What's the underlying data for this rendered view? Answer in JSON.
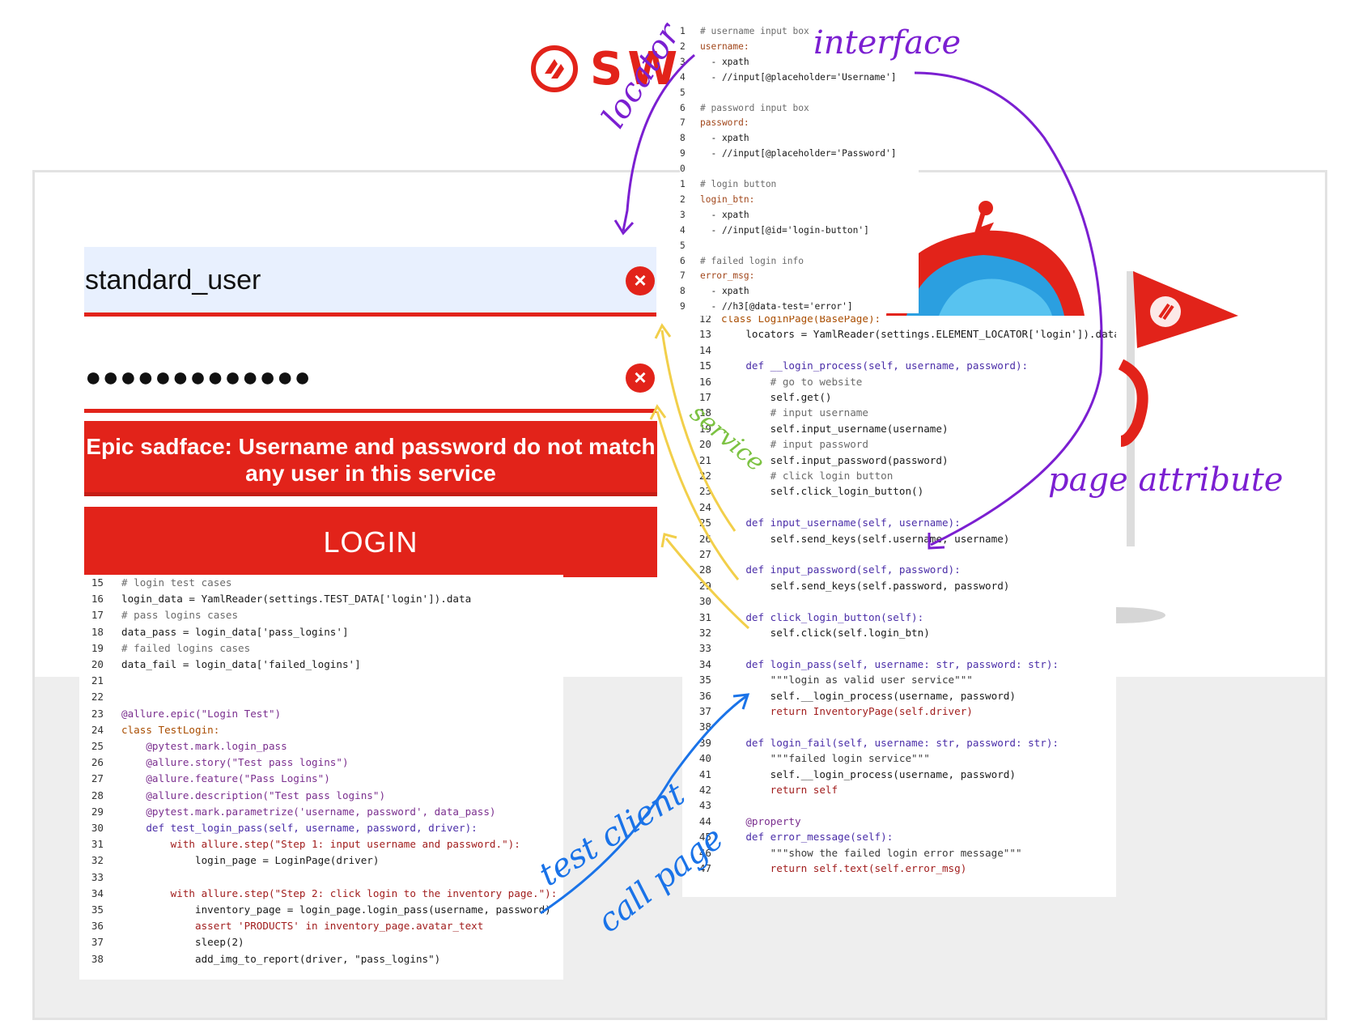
{
  "brand": {
    "text": "SWA"
  },
  "login_form": {
    "username_value": "standard_user",
    "password_value": "●●●●●●●●●●●●●",
    "field_error_icon": "x-circle-icon",
    "error_message": "Epic sadface: Username and password do not match any user in this service",
    "error_close": "✕",
    "login_label": "LOGIN"
  },
  "yaml_code": [
    {
      "n": "1",
      "t": "# username input box",
      "c": "com"
    },
    {
      "n": "2",
      "t": "username:",
      "c": "key"
    },
    {
      "n": "3",
      "t": "  - xpath",
      "c": ""
    },
    {
      "n": "4",
      "t": "  - //input[@placeholder='Username']",
      "c": ""
    },
    {
      "n": "5",
      "t": "",
      "c": ""
    },
    {
      "n": "6",
      "t": "# password input box",
      "c": "com"
    },
    {
      "n": "7",
      "t": "password:",
      "c": "key"
    },
    {
      "n": "8",
      "t": "  - xpath",
      "c": ""
    },
    {
      "n": "9",
      "t": "  - //input[@placeholder='Password']",
      "c": ""
    },
    {
      "n": "0",
      "t": "",
      "c": ""
    },
    {
      "n": "1",
      "t": "# login button",
      "c": "com"
    },
    {
      "n": "2",
      "t": "login_btn:",
      "c": "key"
    },
    {
      "n": "3",
      "t": "  - xpath",
      "c": ""
    },
    {
      "n": "4",
      "t": "  - //input[@id='login-button']",
      "c": ""
    },
    {
      "n": "5",
      "t": "",
      "c": ""
    },
    {
      "n": "6",
      "t": "# failed login info",
      "c": "com"
    },
    {
      "n": "7",
      "t": "error_msg:",
      "c": "key"
    },
    {
      "n": "8",
      "t": "  - xpath",
      "c": ""
    },
    {
      "n": "9",
      "t": "  - //h3[@data-test='error']",
      "c": ""
    }
  ],
  "page_code": [
    {
      "n": "12",
      "t": "class LoginPage(BasePage):",
      "c": "cls"
    },
    {
      "n": "13",
      "t": "    locators = YamlReader(settings.ELEMENT_LOCATOR['login']).data",
      "c": ""
    },
    {
      "n": "14",
      "t": "",
      "c": ""
    },
    {
      "n": "15",
      "t": "    def __login_process(self, username, password):",
      "c": "def"
    },
    {
      "n": "16",
      "t": "        # go to website",
      "c": "com"
    },
    {
      "n": "17",
      "t": "        self.get()",
      "c": ""
    },
    {
      "n": "18",
      "t": "        # input username",
      "c": "com"
    },
    {
      "n": "19",
      "t": "        self.input_username(username)",
      "c": ""
    },
    {
      "n": "20",
      "t": "        # input password",
      "c": "com"
    },
    {
      "n": "21",
      "t": "        self.input_password(password)",
      "c": ""
    },
    {
      "n": "22",
      "t": "        # click login button",
      "c": "com"
    },
    {
      "n": "23",
      "t": "        self.click_login_button()",
      "c": ""
    },
    {
      "n": "24",
      "t": "",
      "c": ""
    },
    {
      "n": "25",
      "t": "    def input_username(self, username):",
      "c": "def"
    },
    {
      "n": "26",
      "t": "        self.send_keys(self.username, username)",
      "c": ""
    },
    {
      "n": "27",
      "t": "",
      "c": ""
    },
    {
      "n": "28",
      "t": "    def input_password(self, password):",
      "c": "def"
    },
    {
      "n": "29",
      "t": "        self.send_keys(self.password, password)",
      "c": ""
    },
    {
      "n": "30",
      "t": "",
      "c": ""
    },
    {
      "n": "31",
      "t": "    def click_login_button(self):",
      "c": "def"
    },
    {
      "n": "32",
      "t": "        self.click(self.login_btn)",
      "c": ""
    },
    {
      "n": "33",
      "t": "",
      "c": ""
    },
    {
      "n": "34",
      "t": "    def login_pass(self, username: str, password: str):",
      "c": "def"
    },
    {
      "n": "35",
      "t": "        \"\"\"login as valid user service\"\"\"",
      "c": "str"
    },
    {
      "n": "36",
      "t": "        self.__login_process(username, password)",
      "c": ""
    },
    {
      "n": "37",
      "t": "        return InventoryPage(self.driver)",
      "c": "ret"
    },
    {
      "n": "38",
      "t": "",
      "c": ""
    },
    {
      "n": "39",
      "t": "    def login_fail(self, username: str, password: str):",
      "c": "def"
    },
    {
      "n": "40",
      "t": "        \"\"\"failed login service\"\"\"",
      "c": "str"
    },
    {
      "n": "41",
      "t": "        self.__login_process(username, password)",
      "c": ""
    },
    {
      "n": "42",
      "t": "        return self",
      "c": "ret"
    },
    {
      "n": "43",
      "t": "",
      "c": ""
    },
    {
      "n": "44",
      "t": "    @property",
      "c": "dec"
    },
    {
      "n": "45",
      "t": "    def error_message(self):",
      "c": "def"
    },
    {
      "n": "46",
      "t": "        \"\"\"show the failed login error message\"\"\"",
      "c": "str"
    },
    {
      "n": "47",
      "t": "        return self.text(self.error_msg)",
      "c": "ret"
    }
  ],
  "test_code": [
    {
      "n": "15",
      "t": "# login test cases",
      "c": "com"
    },
    {
      "n": "16",
      "t": "login_data = YamlReader(settings.TEST_DATA['login']).data",
      "c": ""
    },
    {
      "n": "17",
      "t": "# pass logins cases",
      "c": "com"
    },
    {
      "n": "18",
      "t": "data_pass = login_data['pass_logins']",
      "c": ""
    },
    {
      "n": "19",
      "t": "# failed logins cases",
      "c": "com"
    },
    {
      "n": "20",
      "t": "data_fail = login_data['failed_logins']",
      "c": ""
    },
    {
      "n": "21",
      "t": "",
      "c": ""
    },
    {
      "n": "22",
      "t": "",
      "c": ""
    },
    {
      "n": "23",
      "t": "@allure.epic(\"Login Test\")",
      "c": "dec"
    },
    {
      "n": "24",
      "t": "class TestLogin:",
      "c": "cls"
    },
    {
      "n": "25",
      "t": "    @pytest.mark.login_pass",
      "c": "dec"
    },
    {
      "n": "26",
      "t": "    @allure.story(\"Test pass logins\")",
      "c": "dec"
    },
    {
      "n": "27",
      "t": "    @allure.feature(\"Pass Logins\")",
      "c": "dec"
    },
    {
      "n": "28",
      "t": "    @allure.description(\"Test pass logins\")",
      "c": "dec"
    },
    {
      "n": "29",
      "t": "    @pytest.mark.parametrize('username, password', data_pass)",
      "c": "dec"
    },
    {
      "n": "30",
      "t": "    def test_login_pass(self, username, password, driver):",
      "c": "def"
    },
    {
      "n": "31",
      "t": "        with allure.step(\"Step 1: input username and password.\"):",
      "c": "with"
    },
    {
      "n": "32",
      "t": "            login_page = LoginPage(driver)",
      "c": ""
    },
    {
      "n": "33",
      "t": "",
      "c": ""
    },
    {
      "n": "34",
      "t": "        with allure.step(\"Step 2: click login to the inventory page.\"):",
      "c": "with"
    },
    {
      "n": "35",
      "t": "            inventory_page = login_page.login_pass(username, password)",
      "c": ""
    },
    {
      "n": "36",
      "t": "            assert 'PRODUCTS' in inventory_page.avatar_text",
      "c": "ret"
    },
    {
      "n": "37",
      "t": "            sleep(2)",
      "c": ""
    },
    {
      "n": "38",
      "t": "            add_img_to_report(driver, \"pass_logins\")",
      "c": ""
    }
  ],
  "annotations": {
    "locator": "locator",
    "interface": "interface",
    "service": "service",
    "page_attribute": "page  attribute",
    "test_client": "test client",
    "call_page": "call page"
  },
  "colors": {
    "brand_red": "#e2231a",
    "annot_purple": "#7b1fd1",
    "annot_yellow": "#f2cf4a",
    "annot_green": "#7cc242",
    "annot_blue": "#1a73e8"
  }
}
